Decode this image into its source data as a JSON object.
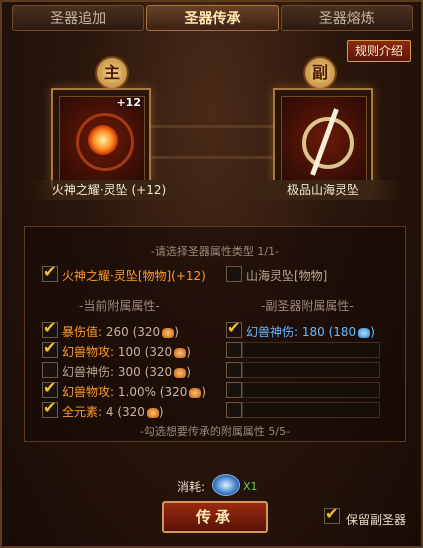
{
  "tabs": [
    {
      "label": "圣器追加",
      "active": false
    },
    {
      "label": "圣器传承",
      "active": true
    },
    {
      "label": "圣器熔炼",
      "active": false
    }
  ],
  "rules_label": "规则介绍",
  "main_badge": "主",
  "sub_badge": "副",
  "main_slot": {
    "level": "+12",
    "name": "火神之耀·灵坠 (+12)"
  },
  "sub_slot": {
    "name": "极品山海灵坠"
  },
  "attr_type_hint": "-请选择圣器属性类型 1/1-",
  "attr_types": [
    {
      "label": "火神之耀·灵坠[物物](+12)",
      "checked": true
    },
    {
      "label": "山海灵坠[物物]",
      "checked": false
    }
  ],
  "current_title": "-当前附属属性-",
  "sub_title": "-副圣器附属属性-",
  "current_attrs": [
    {
      "name": "暴伤值:",
      "value": "260 (320",
      "close": ")",
      "color": "orange",
      "icon": "orange",
      "checked": true
    },
    {
      "name": "幻兽物攻:",
      "value": "100 (320",
      "close": ")",
      "color": "orange",
      "icon": "orange",
      "checked": true
    },
    {
      "name": "幻兽神伤:",
      "value": "300 (320",
      "close": ")",
      "color": "gray",
      "icon": "orange",
      "checked": false
    },
    {
      "name": "幻兽物攻:",
      "value": "1.00% (320",
      "close": ")",
      "color": "orange",
      "icon": "orange",
      "checked": true
    },
    {
      "name": "全元素:",
      "value": "4 (320",
      "close": ")",
      "color": "orange",
      "icon": "orange",
      "checked": true
    }
  ],
  "sub_attrs": [
    {
      "name": "幻兽神伤:",
      "value": "180 (180",
      "close": ")",
      "checked": true,
      "icon": "blue"
    }
  ],
  "select_hint": "-勾选想要传承的附属属性 5/5-",
  "cost_label": "消耗:",
  "cost_qty": "X1",
  "pass_label": "传承",
  "keep_label": "保留副圣器",
  "keep_checked": true,
  "colors": {
    "accent": "#f3c030",
    "attr_orange": "#ff9a2a",
    "attr_blue": "#6ab8ff",
    "qty_green": "#6ad040"
  }
}
